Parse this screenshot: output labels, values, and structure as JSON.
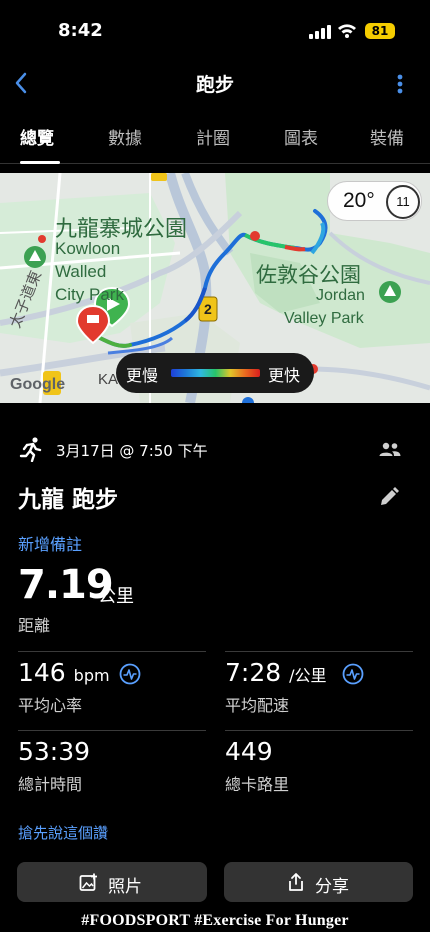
{
  "status_bar": {
    "time": "8:42",
    "battery": "81"
  },
  "nav": {
    "title": "跑步"
  },
  "tabs": [
    {
      "label": "總覽",
      "active": true
    },
    {
      "label": "數據"
    },
    {
      "label": "計圈"
    },
    {
      "label": "圖表"
    },
    {
      "label": "裝備"
    }
  ],
  "map": {
    "labels": {
      "park_zh": "九龍寨城公園",
      "park_en_1": "Kowloon",
      "park_en_2": "Walled",
      "park_en_3": "City Park",
      "jordan_zh": "佐敦谷公園",
      "jordan_en_1": "Jordan",
      "jordan_en_2": "Valley Park",
      "road": "太子道東",
      "area": "KA",
      "google": "Google",
      "route_shield": "2"
    },
    "weather": {
      "temp": "20°",
      "wind": "11"
    },
    "pace_legend": {
      "slower": "更慢",
      "faster": "更快"
    }
  },
  "activity": {
    "date": "3月17日 @ 7:50 下午",
    "title": "九龍 跑步",
    "add_note": "新增備註",
    "distance": {
      "value": "7.19",
      "unit": "公里",
      "label": "距離"
    },
    "stats": {
      "hr": {
        "value": "146",
        "unit": "bpm",
        "label": "平均心率"
      },
      "pace": {
        "value": "7:28",
        "unit": "/公里",
        "label": "平均配速"
      },
      "time": {
        "value": "53:39",
        "label": "總計時間"
      },
      "calories": {
        "value": "449",
        "label": "總卡路里"
      }
    },
    "kudos": "搶先說這個讚",
    "buttons": {
      "photo": "照片",
      "share": "分享"
    }
  },
  "watermark": "#FOODSPORT #Exercise For Hunger",
  "colors": {
    "link": "#5aa0ff",
    "background": "#000000",
    "button": "#333333"
  }
}
